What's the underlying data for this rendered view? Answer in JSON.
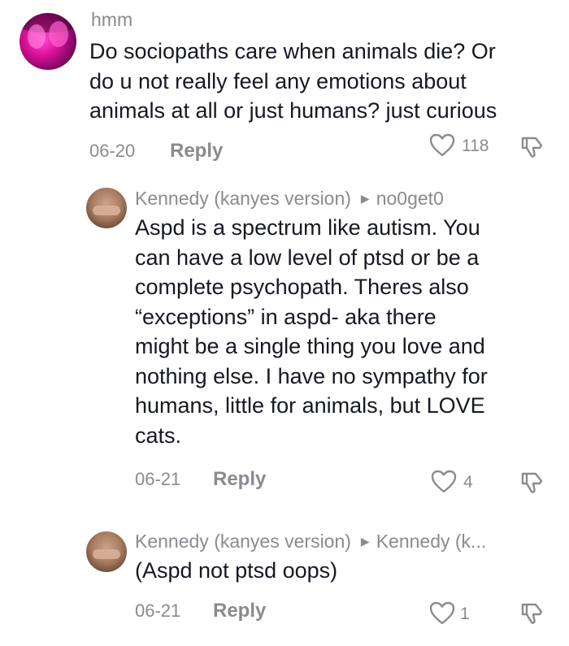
{
  "comments": [
    {
      "author": "hmm",
      "text_lines": [
        "Do sociopaths care when animals die? Or",
        "do u not really feel any emotions about",
        "animals at all or just humans? just curious"
      ],
      "date": "06-20",
      "reply_label": "Reply",
      "likes": "118"
    }
  ],
  "replies": [
    {
      "author": "Kennedy (kanyes version)",
      "reply_to": "no0get0",
      "text_lines": [
        "Aspd is a spectrum like autism. You",
        "can have a low level of ptsd or be a",
        "complete psychopath. Theres also",
        "“exceptions” in aspd- aka there",
        "might be a single thing you love and",
        "nothing else. I have no sympathy for",
        "humans, little for animals, but LOVE",
        "cats."
      ],
      "date": "06-21",
      "reply_label": "Reply",
      "likes": "4"
    },
    {
      "author": "Kennedy (kanyes version)",
      "reply_to": "Kennedy (k...",
      "text_lines": [
        "(Aspd not ptsd oops)"
      ],
      "date": "06-21",
      "reply_label": "Reply",
      "likes": "1"
    }
  ],
  "icons": {
    "like": "heart-outline-icon",
    "dislike": "thumbs-down-icon",
    "reply_arrow": "triangle-right-icon"
  },
  "colors": {
    "text": "#161823",
    "muted": "#8a8b91"
  }
}
